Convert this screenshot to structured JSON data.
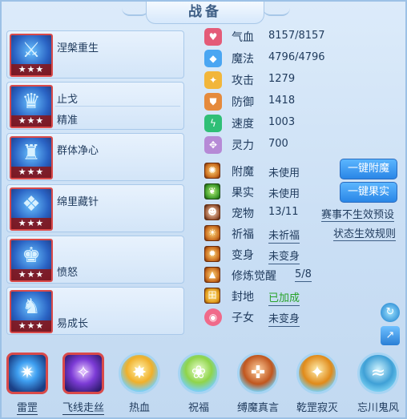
{
  "title": "战备",
  "skills": [
    {
      "name": "涅槃重生",
      "sub": "",
      "icon": "sword-icon"
    },
    {
      "name": "止戈",
      "sub": "精准",
      "icon": "helm-icon"
    },
    {
      "name": "群体净心",
      "sub": "",
      "icon": "blue-helm-icon"
    },
    {
      "name": "绵里藏针",
      "sub": "",
      "icon": "crest-icon"
    },
    {
      "name": "",
      "sub": "愤怒",
      "icon": "crown-icon"
    },
    {
      "name": "",
      "sub": "易成长",
      "icon": "wing-helm-icon"
    }
  ],
  "stars": "★★★",
  "stats": [
    {
      "label": "气血",
      "value": "8157/8157",
      "color": "#e45b78"
    },
    {
      "label": "魔法",
      "value": "4796/4796",
      "color": "#4aa6f2"
    },
    {
      "label": "攻击",
      "value": "1279",
      "color": "#f2b63a"
    },
    {
      "label": "防御",
      "value": "1418",
      "color": "#e58a3c"
    },
    {
      "label": "速度",
      "value": "1003",
      "color": "#2fbf76"
    },
    {
      "label": "灵力",
      "value": "700",
      "color": "#b68ad6"
    }
  ],
  "extras": [
    {
      "label": "附魔",
      "value": "未使用"
    },
    {
      "label": "果实",
      "value": "未使用"
    },
    {
      "label": "宠物",
      "value": "13/11"
    },
    {
      "label": "祈福",
      "value": "未祈福"
    },
    {
      "label": "变身",
      "value": "未变身"
    },
    {
      "label": "修炼觉醒",
      "value": "5/8"
    },
    {
      "label": "封地",
      "value": "已加成"
    },
    {
      "label": "子女",
      "value": "未变身"
    }
  ],
  "buttons": {
    "one_click_enchant": "一键附魔",
    "one_click_fruit": "一键果实"
  },
  "links": {
    "no_effect_preset": "赛事不生效预设",
    "state_effect_rules": "状态生效规则"
  },
  "bottom": [
    {
      "label": "雷罡",
      "icon": "lightning-orb-icon"
    },
    {
      "label": "飞线走丝",
      "icon": "thread-icon"
    },
    {
      "label": "热血",
      "icon": "hot-blood-icon"
    },
    {
      "label": "祝福",
      "icon": "blessing-icon"
    },
    {
      "label": "缚魔真言",
      "icon": "bind-demon-icon"
    },
    {
      "label": "乾罡寂灭",
      "icon": "annihilate-icon"
    },
    {
      "label": "忘川鬼风",
      "icon": "ghost-wind-icon"
    }
  ]
}
